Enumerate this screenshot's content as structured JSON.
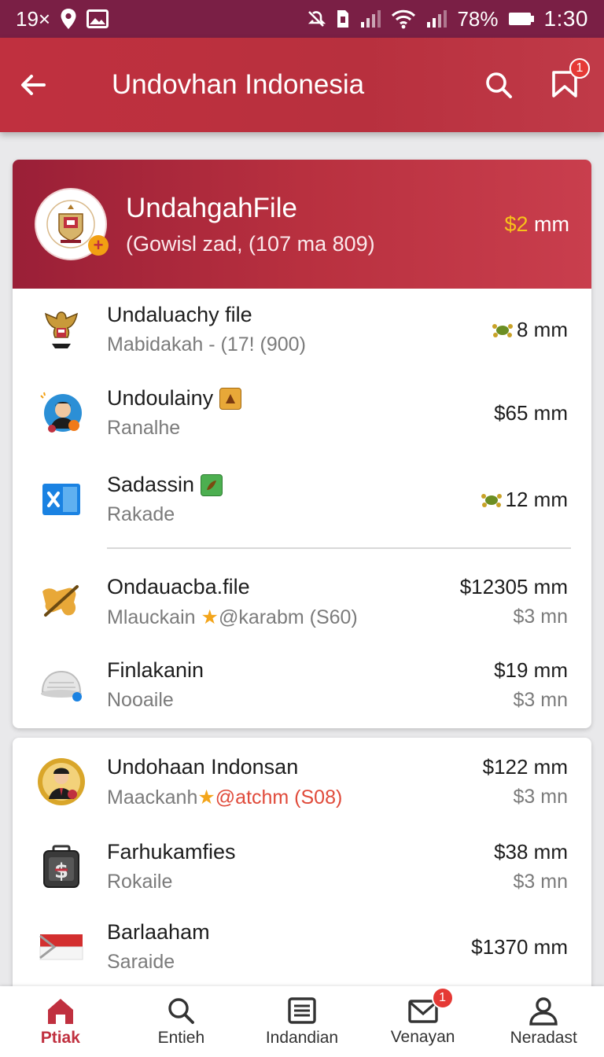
{
  "status_bar": {
    "left_text": "19×",
    "battery": "78%",
    "time": "1:30"
  },
  "app_bar": {
    "title": "Undovhan Indonesia",
    "notification_count": "1"
  },
  "featured": {
    "title": "UndahgahFile",
    "subtitle": "(Gowisl zad,  (107 ma 809)",
    "price_symbol": "$2",
    "price_unit": " mm"
  },
  "list1": [
    {
      "title": "Undaluachy file",
      "subtitle": "Mabidakah - (17! (900)",
      "price": "8 mm",
      "price_icon": "tortoise-icon"
    },
    {
      "title": "Undoulainy",
      "subtitle": "Ranalhe",
      "price": "$65 mm"
    },
    {
      "title": "Sadassin",
      "subtitle": "Rakade",
      "price": "12 mm",
      "price_icon": "tortoise-icon"
    },
    {
      "title": "Ondauacba.file",
      "subtitle_a": "Mlauckain",
      "subtitle_b": "@karabm (S60)",
      "price": "$12305 mm",
      "price2": "$3 mn"
    },
    {
      "title": "Finlakanin",
      "subtitle": "Nooaile",
      "price": "$19 mm",
      "price2": "$3 mn"
    }
  ],
  "list2": [
    {
      "title": "Undohaan Indonsan",
      "subtitle_a": "Maackanh",
      "subtitle_b": "@atchm (S08)",
      "price": "$122 mm",
      "price2": "$3 mn"
    },
    {
      "title": "Farhukamfies",
      "subtitle": "Rokaile",
      "price": "$38 mm",
      "price2": "$3 mn"
    },
    {
      "title": "Barlaaham",
      "subtitle": "Saraide",
      "price": "$1370 mm"
    }
  ],
  "bottom_nav": [
    {
      "label": "Ptiak",
      "icon": "home-icon"
    },
    {
      "label": "Entieh",
      "icon": "search-icon"
    },
    {
      "label": "Indandian",
      "icon": "list-icon"
    },
    {
      "label": "Venayan",
      "icon": "mail-icon",
      "badge": "1"
    },
    {
      "label": "Neradast",
      "icon": "profile-icon"
    }
  ],
  "colors": {
    "status_bar": "#7a1f45",
    "app_bar": "#c0303f",
    "accent_gold": "#f7c21a",
    "active_nav": "#c0303f"
  }
}
